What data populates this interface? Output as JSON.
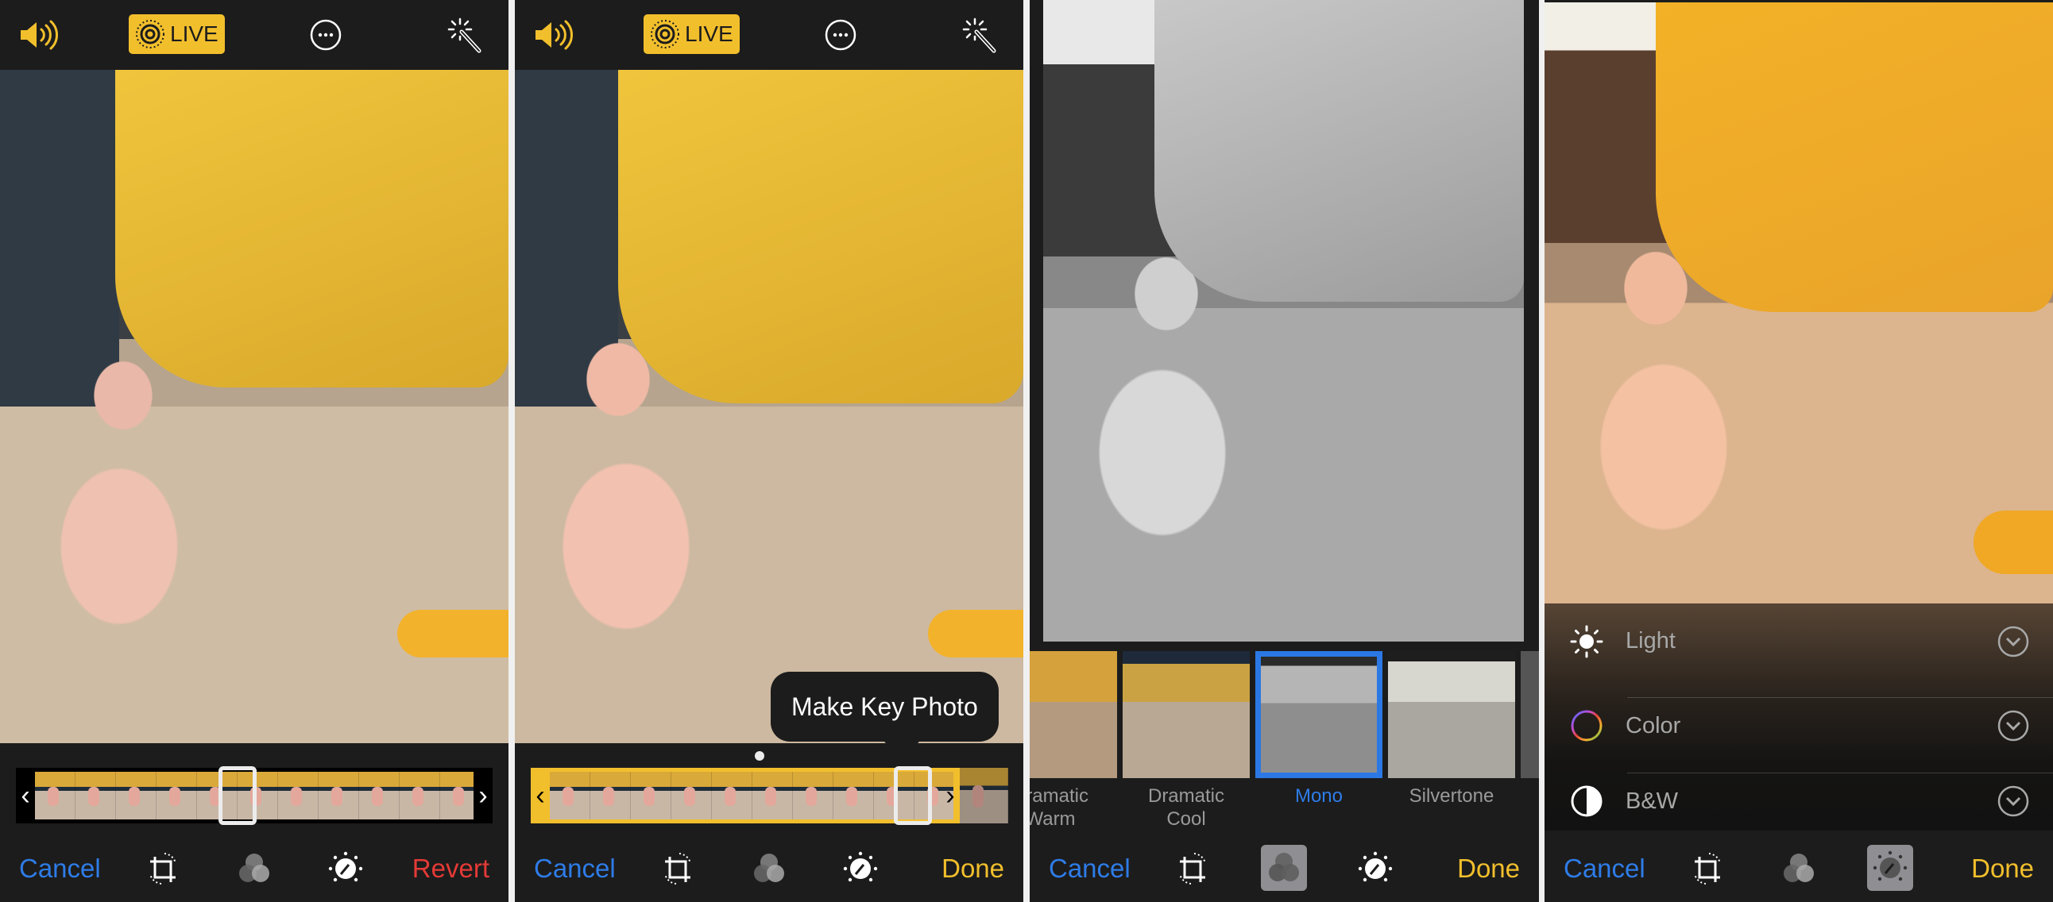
{
  "colors": {
    "background": "#1c1c1c",
    "cancel_blue": "#2e7ce8",
    "done_yellow": "#f2bf2c",
    "revert_red": "#e43a36",
    "live_badge": "#f2bf2c",
    "selected_filter_border": "#2b78e4",
    "filter_label": "#9a9a9a"
  },
  "panels": [
    {
      "id": "live-photo-edit",
      "topbar": {
        "sound_icon": "speaker-icon",
        "live_label": "LIVE",
        "more_icon": "ellipsis-circle-icon",
        "enhance_icon": "magic-wand-icon"
      },
      "filmstrip": {
        "style": "default",
        "frames": 11,
        "selected_frame": 5
      },
      "toolbar": {
        "cancel": "Cancel",
        "right_action": "Revert",
        "crop_icon": "crop-rotate-icon",
        "filters_icon": "filters-icon",
        "adjust_icon": "adjust-dial-icon"
      }
    },
    {
      "id": "key-photo-select",
      "topbar": {
        "sound_icon": "speaker-icon",
        "live_label": "LIVE",
        "more_icon": "ellipsis-circle-icon",
        "enhance_icon": "magic-wand-icon"
      },
      "tooltip": "Make Key Photo",
      "filmstrip": {
        "style": "trim-active",
        "frames": 11,
        "selected_frame": 10
      },
      "toolbar": {
        "cancel": "Cancel",
        "right_action": "Done"
      }
    },
    {
      "id": "filters",
      "filters": [
        {
          "label": "Dramatic Warm",
          "line1": "Dramatic",
          "line2": "Warm",
          "selected": false
        },
        {
          "label": "Dramatic Cool",
          "line1": "Dramatic",
          "line2": "Cool",
          "selected": false
        },
        {
          "label": "Mono",
          "line1": "Mono",
          "line2": "",
          "selected": true
        },
        {
          "label": "Silvertone",
          "line1": "Silvertone",
          "line2": "",
          "selected": false
        }
      ],
      "toolbar": {
        "cancel": "Cancel",
        "right_action": "Done",
        "active_tool": "filters"
      }
    },
    {
      "id": "adjustments",
      "adjustments": [
        {
          "label": "Light",
          "icon": "sun-icon"
        },
        {
          "label": "Color",
          "icon": "color-wheel-icon"
        },
        {
          "label": "B&W",
          "icon": "half-circle-icon"
        }
      ],
      "toolbar": {
        "cancel": "Cancel",
        "right_action": "Done",
        "active_tool": "adjust"
      }
    }
  ]
}
